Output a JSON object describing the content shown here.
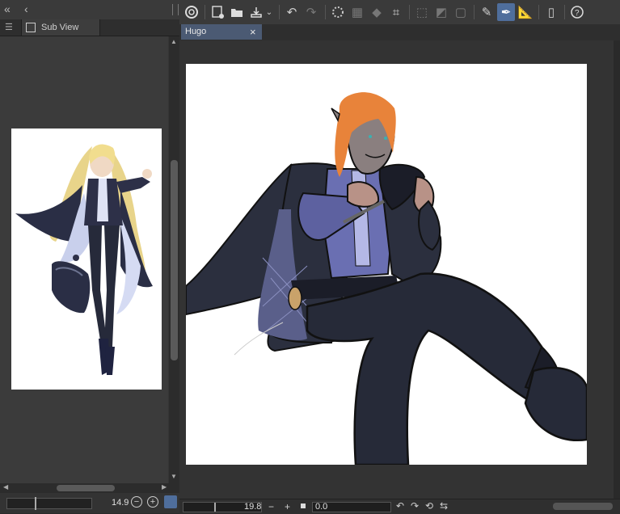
{
  "left_panel": {
    "collapse_label": "«",
    "back_label": "‹",
    "menu_icon": "☰",
    "tab_label": "Sub View"
  },
  "left_bottom": {
    "zoom_value": "14.9",
    "zoom_out": "−",
    "zoom_in": "+"
  },
  "toolbar": {
    "icons": [
      "clip-studio-logo-icon",
      "new-file-icon",
      "open-folder-icon",
      "save-icon",
      "dropdown-icon",
      "undo-icon",
      "redo-icon",
      "loading-spinner-icon",
      "transform-icon",
      "fill-icon",
      "crop-icon",
      "deselect-icon",
      "invert-selection-icon",
      "selection-border-icon",
      "brush-tool-icon",
      "pen-tool-icon",
      "ruler-tool-icon",
      "device-icon",
      "help-icon"
    ]
  },
  "document": {
    "tab_title": "Hugo",
    "tab_close": "×"
  },
  "status_bar": {
    "zoom_value": "19.8",
    "rotate_value": "0.0",
    "minus": "−",
    "plus": "+"
  },
  "colors": {
    "accent": "#4f6e9c",
    "tab_active": "#4b5a73",
    "hair": "#e8833a",
    "jacket": "#2b2f3e",
    "shirt": "#6a6fb2",
    "pants": "#262a38"
  }
}
